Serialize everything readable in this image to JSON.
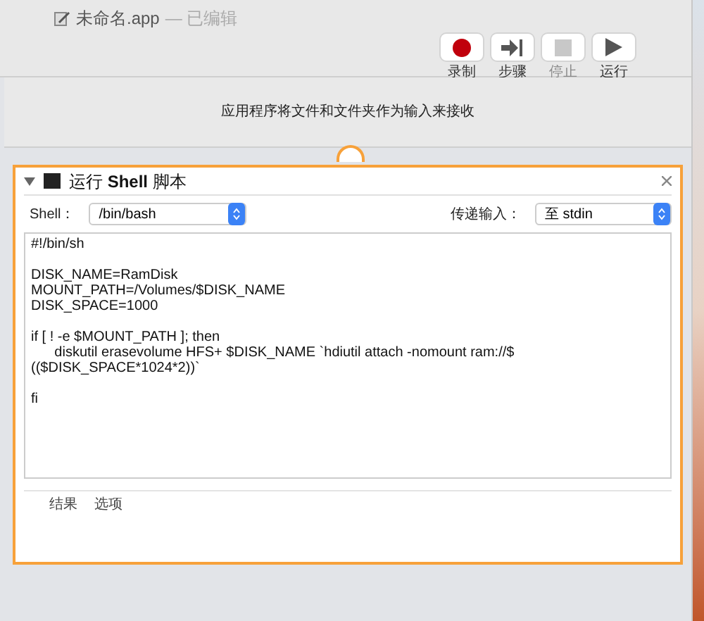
{
  "window": {
    "title": "未命名.app",
    "status": "— 已编辑"
  },
  "toolbar": [
    {
      "kind": "record",
      "label": "录制",
      "disabled": false
    },
    {
      "kind": "step",
      "label": "步骤",
      "disabled": false
    },
    {
      "kind": "stop",
      "label": "停止",
      "disabled": true
    },
    {
      "kind": "run",
      "label": "运行",
      "disabled": false
    }
  ],
  "input_banner": "应用程序将文件和文件夹作为输入来接收",
  "action": {
    "title": "运行 **Shell** 脚本",
    "expanded": true,
    "shell_label": "Shell：",
    "shell_value": "/bin/bash",
    "pass_input_label": "传递输入：",
    "pass_input_value": "至 stdin",
    "script": "#!/bin/sh\n\nDISK_NAME=RamDisk\nMOUNT_PATH=/Volumes/$DISK_NAME\nDISK_SPACE=1000\n\nif [ ! -e $MOUNT_PATH ]; then\n\tdiskutil erasevolume HFS+ $DISK_NAME `hdiutil attach -nomount ram://$\n(($DISK_SPACE*1024*2))`\n\nfi",
    "footer_tabs": [
      {
        "label": "结果",
        "selected": false
      },
      {
        "label": "选项",
        "selected": false
      }
    ]
  }
}
